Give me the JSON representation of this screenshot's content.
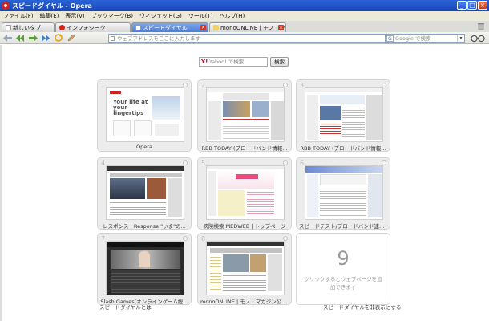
{
  "window": {
    "title": "スピードダイヤル - Opera"
  },
  "menu": [
    "ファイル(F)",
    "編集(E)",
    "表示(V)",
    "ブックマーク(B)",
    "ウィジェット(G)",
    "ツール(T)",
    "ヘルプ(H)"
  ],
  "tabs": [
    {
      "label": "新しいタブ",
      "icon": "doc-icon",
      "active": false
    },
    {
      "label": "インフォシーク",
      "icon": "opera-icon",
      "active": false
    },
    {
      "label": "スピードダイヤル",
      "icon": "doc-icon",
      "active": true
    },
    {
      "label": "monoONLINE | モノ・マガ...",
      "icon": "note-icon",
      "active": false
    }
  ],
  "address": {
    "placeholder": "ウェブアドレスをここに入力します"
  },
  "search": {
    "placeholder": "Google で検索",
    "engine_icon": "G"
  },
  "yahoo": {
    "placeholder": "Yahoo! で検索",
    "button": "検索",
    "logo": "Y!"
  },
  "dials": [
    {
      "num": "1",
      "label": "Opera",
      "thumb": "opera"
    },
    {
      "num": "2",
      "label": "RBB TODAY (ブロードバンド情報...",
      "thumb": "rbb"
    },
    {
      "num": "3",
      "label": "RBB TODAY (ブロードバンド情報...",
      "thumb": "rbb2"
    },
    {
      "num": "4",
      "label": "レスポンス | Response \"いま\"の...",
      "thumb": "response"
    },
    {
      "num": "5",
      "label": "病院検索 MEDWEB | トップページ",
      "thumb": "medweb"
    },
    {
      "num": "6",
      "label": "スピードテスト/ブロードバンド速度...",
      "thumb": "speed"
    },
    {
      "num": "7",
      "label": "Slash Games(オンラインゲーム総...",
      "thumb": "slash"
    },
    {
      "num": "8",
      "label": "monoONLINE | モノ・マガジン公式...",
      "thumb": "mono"
    }
  ],
  "empty_dial": {
    "num": "9",
    "hint": "クリックするとウェブページを追加できます"
  },
  "footer": {
    "left": "スピードダイヤルとは",
    "right": "スピードダイヤルを非表示にする"
  },
  "thumb_text": {
    "opera_headline": "Your life at your fingertips"
  },
  "colors": {
    "titlebar": "#2458d3",
    "active_tab": "#4b7ed8",
    "opera_red": "#d62018"
  }
}
